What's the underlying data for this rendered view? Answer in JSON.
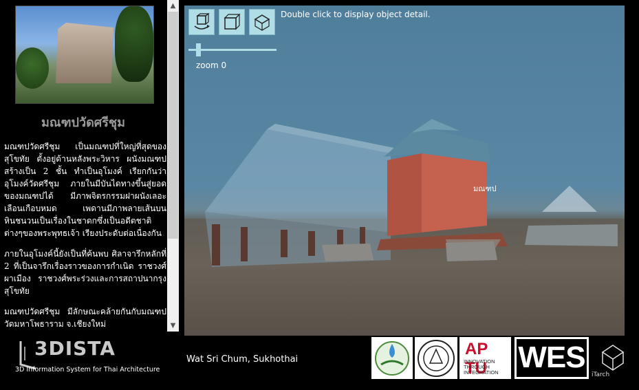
{
  "sidebar": {
    "title": "มณฑปวัดศรีชุม",
    "paragraphs": [
      "มณฑปวัดศรีชุม เป็นมณฑปที่ใหญ่ที่สุดของสุโขทัย ตั้งอยู่ด้านหลังพระวิหาร ผนังมณฑปสร้างเป็น 2 ชั้น ทำเป็นอุโมงค์ เรียกกันว่า อุโมงค์วัดศรีชุม ภายในมีบันไดทางขึ้นสู่ยอดของมณฑปได้ มีภาพจิตรกรรมฝาผนังเลอะเลือนเกือบหมด เพดานมีภาพลายเส้นบนหินชนวนเป็นเรื่องในชาดกซึ่งเป็นอดีตชาติต่างๆของพระพุทธเจ้า เรียงประดับต่อเนื่องกัน",
      "ภายในอุโมงค์นี้ยังเป็นที่ค้นพบ ศิลาจารึกหลักที่ 2 ที่เป็นจารึกเรื่องราวของการกำเนิด ราชวงศ์ผาเมือง ราชวงศ์พระร่วงและการสถาปนากรุงสุโขทัย",
      "มณฑปวัดศรีชุม มีลักษณะคล้ายกันกับมณฑป วัดมหาโพธาราม จ.เชียงใหม่"
    ]
  },
  "viewer": {
    "hint": "Double click to display object detail.",
    "zoom_label": "zoom 0",
    "zoom_value": 0,
    "object_label": "มณฑป",
    "tools": [
      "rotate-view-icon",
      "cube-front-icon",
      "cube-top-icon"
    ]
  },
  "footer": {
    "logo_title": "3DISTA",
    "logo_subtitle": "3D Information System for Thai Architecture",
    "caption": "Wat Sri Chum, Sukhothai",
    "aptu_title": "AP TU",
    "aptu_sub_1": "INNOVATION",
    "aptu_sub_2": "THROUGH",
    "aptu_sub_3": "INTEGRATION",
    "wes_title": "WES",
    "itarch_label": "iTarch"
  },
  "colors": {
    "sky": "#5a87a3",
    "toolbar": "#b0dde6",
    "temple_brick": "#c4614f",
    "aptu_red": "#c8102e"
  }
}
